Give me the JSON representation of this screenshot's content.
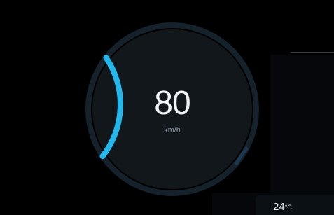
{
  "speedometer": {
    "speed": "80",
    "unit": "km/h",
    "progress": 0.2,
    "accent_color": "#22b8ee",
    "track_color": "#15212b",
    "dial_color": "#12171c"
  },
  "climate": {
    "temperature": "24",
    "unit": "°C"
  }
}
